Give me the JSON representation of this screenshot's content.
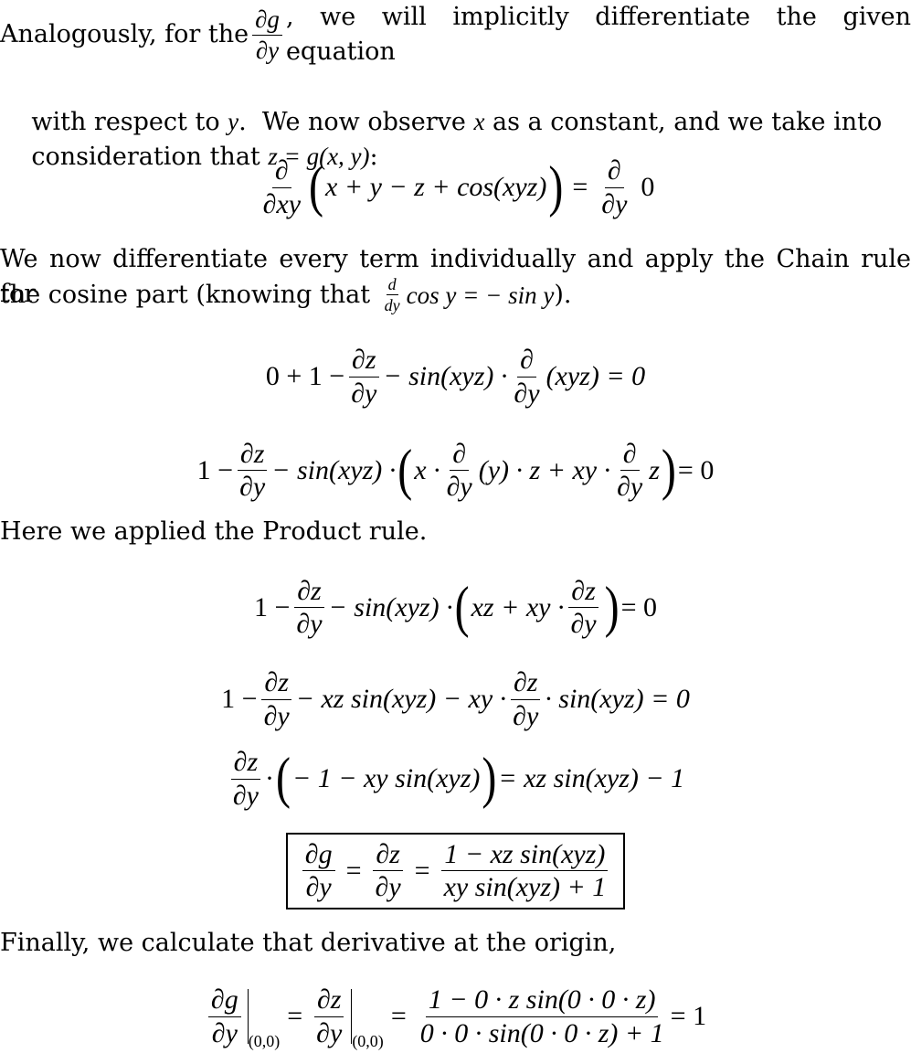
{
  "paragraphs": {
    "p1": {
      "line1_before": "Analogously, for the",
      "frac_num": "∂g",
      "frac_den": "∂y",
      "line1_after": ", we will implicitly differentiate the given equation",
      "line2_a": "with respect to ",
      "line2_var": "y",
      "line2_b": ".  We now observe ",
      "line2_var2": "x",
      "line2_c": " as a constant, and we take into",
      "line3_a": "consideration that ",
      "line3_math": "z = g(x, y)",
      "line3_b": ":"
    },
    "p2": {
      "line1": "We now differentiate every term individually and apply the Chain rule for",
      "line2_a": "the cosine part (knowing that ",
      "d_num": "d",
      "d_den": "dy",
      "line2_math": "cos y = − sin y",
      "line2_b": ")."
    },
    "p3": {
      "text": "Here we applied the Product rule."
    },
    "p4": {
      "text": "Finally, we calculate that derivative at the origin,"
    }
  },
  "equations": {
    "eq1": {
      "d_num": "∂",
      "d_den": "∂xy",
      "body": "x + y − z + cos(xyz)",
      "eq": "=",
      "rhs_num": "∂",
      "rhs_den": "∂y",
      "rhs": "0"
    },
    "eq2": {
      "lhs": "0 + 1 −",
      "f1_num": "∂z",
      "f1_den": "∂y",
      "mid": "− sin(xyz) ·",
      "f2_num": "∂",
      "f2_den": "∂y",
      "tail": "(xyz) = 0"
    },
    "eq3": {
      "lhs": "1 −",
      "f1_num": "∂z",
      "f1_den": "∂y",
      "mid": "− sin(xyz) ·",
      "in1": "x ·",
      "f2_num": "∂",
      "f2_den": "∂y",
      "in2": "(y) · z + xy ·",
      "f3_num": "∂",
      "f3_den": "∂y",
      "in3": "z",
      "tail": "= 0"
    },
    "eq4": {
      "lhs": "1 −",
      "f1_num": "∂z",
      "f1_den": "∂y",
      "mid": "− sin(xyz) ·",
      "in1": "xz + xy ·",
      "f2_num": "∂z",
      "f2_den": "∂y",
      "tail": "= 0"
    },
    "eq5": {
      "lhs": "1 −",
      "f1_num": "∂z",
      "f1_den": "∂y",
      "mid": "− xz sin(xyz) − xy ·",
      "f2_num": "∂z",
      "f2_den": "∂y",
      "tail": "· sin(xyz) = 0"
    },
    "eq6": {
      "f1_num": "∂z",
      "f1_den": "∂y",
      "dot": "·",
      "inner": "− 1 − xy sin(xyz)",
      "tail": "= xz sin(xyz) − 1"
    },
    "eq7": {
      "f1_num": "∂g",
      "f1_den": "∂y",
      "eq1": "=",
      "f2_num": "∂z",
      "f2_den": "∂y",
      "eq2": "=",
      "f3_num": "1 − xz sin(xyz)",
      "f3_den": "xy sin(xyz) + 1"
    },
    "eq8": {
      "f1_num": "∂g",
      "f1_den": "∂y",
      "sub1": "(0,0)",
      "eq1": "=",
      "f2_num": "∂z",
      "f2_den": "∂y",
      "sub2": "(0,0)",
      "eq2": "=",
      "f3_num": "1 − 0 · z sin(0 · 0 · z)",
      "f3_den": "0 · 0 · sin(0 · 0 · z) + 1",
      "tail": "= 1"
    }
  }
}
